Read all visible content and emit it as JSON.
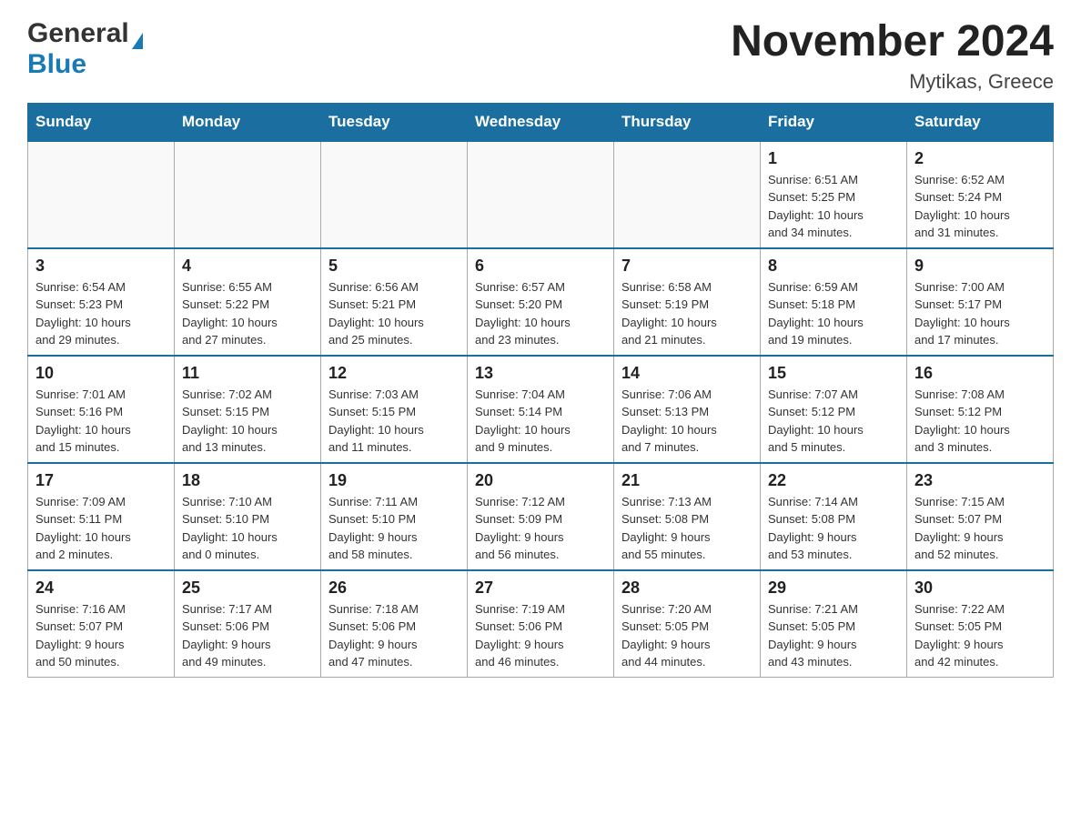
{
  "header": {
    "logo_general": "General",
    "logo_blue": "Blue",
    "title": "November 2024",
    "subtitle": "Mytikas, Greece"
  },
  "days_of_week": [
    "Sunday",
    "Monday",
    "Tuesday",
    "Wednesday",
    "Thursday",
    "Friday",
    "Saturday"
  ],
  "weeks": [
    [
      {
        "day": "",
        "info": ""
      },
      {
        "day": "",
        "info": ""
      },
      {
        "day": "",
        "info": ""
      },
      {
        "day": "",
        "info": ""
      },
      {
        "day": "",
        "info": ""
      },
      {
        "day": "1",
        "info": "Sunrise: 6:51 AM\nSunset: 5:25 PM\nDaylight: 10 hours\nand 34 minutes."
      },
      {
        "day": "2",
        "info": "Sunrise: 6:52 AM\nSunset: 5:24 PM\nDaylight: 10 hours\nand 31 minutes."
      }
    ],
    [
      {
        "day": "3",
        "info": "Sunrise: 6:54 AM\nSunset: 5:23 PM\nDaylight: 10 hours\nand 29 minutes."
      },
      {
        "day": "4",
        "info": "Sunrise: 6:55 AM\nSunset: 5:22 PM\nDaylight: 10 hours\nand 27 minutes."
      },
      {
        "day": "5",
        "info": "Sunrise: 6:56 AM\nSunset: 5:21 PM\nDaylight: 10 hours\nand 25 minutes."
      },
      {
        "day": "6",
        "info": "Sunrise: 6:57 AM\nSunset: 5:20 PM\nDaylight: 10 hours\nand 23 minutes."
      },
      {
        "day": "7",
        "info": "Sunrise: 6:58 AM\nSunset: 5:19 PM\nDaylight: 10 hours\nand 21 minutes."
      },
      {
        "day": "8",
        "info": "Sunrise: 6:59 AM\nSunset: 5:18 PM\nDaylight: 10 hours\nand 19 minutes."
      },
      {
        "day": "9",
        "info": "Sunrise: 7:00 AM\nSunset: 5:17 PM\nDaylight: 10 hours\nand 17 minutes."
      }
    ],
    [
      {
        "day": "10",
        "info": "Sunrise: 7:01 AM\nSunset: 5:16 PM\nDaylight: 10 hours\nand 15 minutes."
      },
      {
        "day": "11",
        "info": "Sunrise: 7:02 AM\nSunset: 5:15 PM\nDaylight: 10 hours\nand 13 minutes."
      },
      {
        "day": "12",
        "info": "Sunrise: 7:03 AM\nSunset: 5:15 PM\nDaylight: 10 hours\nand 11 minutes."
      },
      {
        "day": "13",
        "info": "Sunrise: 7:04 AM\nSunset: 5:14 PM\nDaylight: 10 hours\nand 9 minutes."
      },
      {
        "day": "14",
        "info": "Sunrise: 7:06 AM\nSunset: 5:13 PM\nDaylight: 10 hours\nand 7 minutes."
      },
      {
        "day": "15",
        "info": "Sunrise: 7:07 AM\nSunset: 5:12 PM\nDaylight: 10 hours\nand 5 minutes."
      },
      {
        "day": "16",
        "info": "Sunrise: 7:08 AM\nSunset: 5:12 PM\nDaylight: 10 hours\nand 3 minutes."
      }
    ],
    [
      {
        "day": "17",
        "info": "Sunrise: 7:09 AM\nSunset: 5:11 PM\nDaylight: 10 hours\nand 2 minutes."
      },
      {
        "day": "18",
        "info": "Sunrise: 7:10 AM\nSunset: 5:10 PM\nDaylight: 10 hours\nand 0 minutes."
      },
      {
        "day": "19",
        "info": "Sunrise: 7:11 AM\nSunset: 5:10 PM\nDaylight: 9 hours\nand 58 minutes."
      },
      {
        "day": "20",
        "info": "Sunrise: 7:12 AM\nSunset: 5:09 PM\nDaylight: 9 hours\nand 56 minutes."
      },
      {
        "day": "21",
        "info": "Sunrise: 7:13 AM\nSunset: 5:08 PM\nDaylight: 9 hours\nand 55 minutes."
      },
      {
        "day": "22",
        "info": "Sunrise: 7:14 AM\nSunset: 5:08 PM\nDaylight: 9 hours\nand 53 minutes."
      },
      {
        "day": "23",
        "info": "Sunrise: 7:15 AM\nSunset: 5:07 PM\nDaylight: 9 hours\nand 52 minutes."
      }
    ],
    [
      {
        "day": "24",
        "info": "Sunrise: 7:16 AM\nSunset: 5:07 PM\nDaylight: 9 hours\nand 50 minutes."
      },
      {
        "day": "25",
        "info": "Sunrise: 7:17 AM\nSunset: 5:06 PM\nDaylight: 9 hours\nand 49 minutes."
      },
      {
        "day": "26",
        "info": "Sunrise: 7:18 AM\nSunset: 5:06 PM\nDaylight: 9 hours\nand 47 minutes."
      },
      {
        "day": "27",
        "info": "Sunrise: 7:19 AM\nSunset: 5:06 PM\nDaylight: 9 hours\nand 46 minutes."
      },
      {
        "day": "28",
        "info": "Sunrise: 7:20 AM\nSunset: 5:05 PM\nDaylight: 9 hours\nand 44 minutes."
      },
      {
        "day": "29",
        "info": "Sunrise: 7:21 AM\nSunset: 5:05 PM\nDaylight: 9 hours\nand 43 minutes."
      },
      {
        "day": "30",
        "info": "Sunrise: 7:22 AM\nSunset: 5:05 PM\nDaylight: 9 hours\nand 42 minutes."
      }
    ]
  ]
}
